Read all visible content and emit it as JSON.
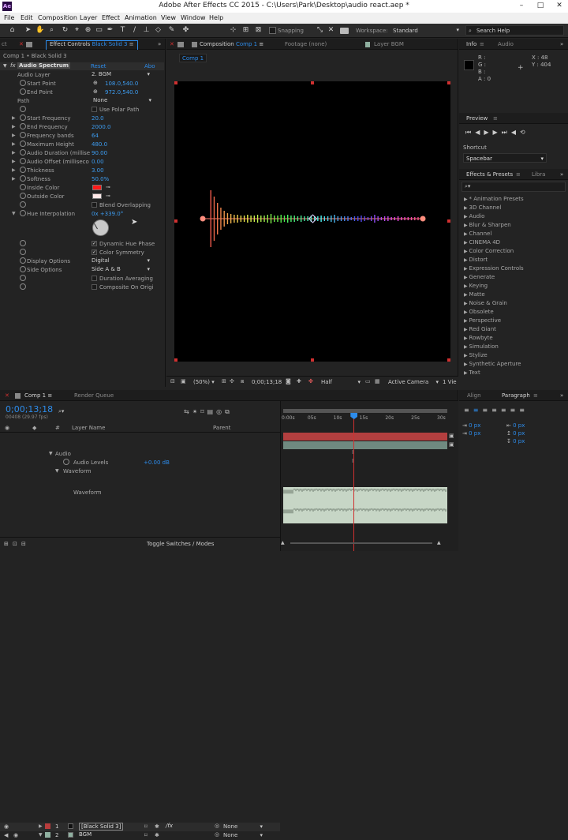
{
  "app": {
    "title": "Adobe After Effects CC 2015 - C:\\Users\\Park\\Desktop\\audio react.aep *",
    "logo": "Ae"
  },
  "menu": [
    "File",
    "Edit",
    "Composition",
    "Layer",
    "Effect",
    "Animation",
    "View",
    "Window",
    "Help"
  ],
  "toolbar": {
    "snapping": "Snapping",
    "workspace_label": "Workspace:",
    "workspace_value": "Standard",
    "search_placeholder": "Search Help"
  },
  "effect_controls": {
    "tab_prev": "ct",
    "tab_label": "Effect Controls",
    "tab_layer": "Black Solid 3",
    "breadcrumb": "Comp 1 • Black Solid 3",
    "effect_name": "Audio Spectrum",
    "reset": "Reset",
    "about": "Abo",
    "props": {
      "audio_layer": {
        "label": "Audio Layer",
        "value": "2. BGM"
      },
      "start_point": {
        "label": "Start Point",
        "value": "108.0,540.0"
      },
      "end_point": {
        "label": "End Point",
        "value": "972.0,540.0"
      },
      "path": {
        "label": "Path",
        "value": "None"
      },
      "use_polar": {
        "label": "Use Polar Path"
      },
      "start_freq": {
        "label": "Start Frequency",
        "value": "20.0"
      },
      "end_freq": {
        "label": "End Frequency",
        "value": "2000.0"
      },
      "freq_bands": {
        "label": "Frequency bands",
        "value": "64"
      },
      "max_height": {
        "label": "Maximum Height",
        "value": "480.0"
      },
      "audio_duration": {
        "label": "Audio Duration (millise",
        "value": "90.00"
      },
      "audio_offset": {
        "label": "Audio Offset (milliseco",
        "value": "0.00"
      },
      "thickness": {
        "label": "Thickness",
        "value": "3.00"
      },
      "softness": {
        "label": "Softness",
        "value": "50.0%"
      },
      "inside_color": {
        "label": "Inside Color",
        "color": "#ff1a1a"
      },
      "outside_color": {
        "label": "Outside Color",
        "color": "#ffe8e8"
      },
      "blend_overlapping": {
        "label": "Blend Overlapping"
      },
      "hue_interp": {
        "label": "Hue Interpolation",
        "value": "0x +339.0°"
      },
      "dynamic_hue": {
        "label": "Dynamic Hue Phase"
      },
      "color_symmetry": {
        "label": "Color Symmetry"
      },
      "display_options": {
        "label": "Display Options",
        "value": "Digital"
      },
      "side_options": {
        "label": "Side Options",
        "value": "Side A & B"
      },
      "duration_avg": {
        "label": "Duration Averaging"
      },
      "composite": {
        "label": "Composite On Origi"
      }
    }
  },
  "composition": {
    "tab_label": "Composition",
    "tab_name": "Comp 1",
    "footage_tab": "Footage (none)",
    "layer_tab": "Layer BGM",
    "comp_chip": "Comp 1",
    "zoom": "(50%)",
    "timecode": "0;00;13;18",
    "resolution": "Half",
    "camera": "Active Camera",
    "views": "1 Vie"
  },
  "info": {
    "tab_info": "Info",
    "tab_audio": "Audio",
    "r": "R :",
    "g": "G :",
    "b": "B :",
    "a": "A : 0",
    "x": "X : 48",
    "y": "Y : 404"
  },
  "preview": {
    "title": "Preview",
    "shortcut_label": "Shortcut",
    "shortcut_value": "Spacebar"
  },
  "effects_presets": {
    "title": "Effects & Presets",
    "tab_lib": "Libra",
    "items": [
      "* Animation Presets",
      "3D Channel",
      "Audio",
      "Blur & Sharpen",
      "Channel",
      "CINEMA 4D",
      "Color Correction",
      "Distort",
      "Expression Controls",
      "Generate",
      "Keying",
      "Matte",
      "Noise & Grain",
      "Obsolete",
      "Perspective",
      "Red Giant",
      "Rowbyte",
      "Simulation",
      "Stylize",
      "Synthetic Aperture",
      "Text"
    ]
  },
  "align": {
    "tab_align": "Align",
    "tab_paragraph": "Paragraph",
    "px_values": [
      "0 px",
      "0 px",
      "0 px",
      "0 px",
      "0 px"
    ]
  },
  "timeline": {
    "tab_comp": "Comp 1",
    "tab_render": "Render Queue",
    "timecode": "0;00;13;18",
    "fps": "00408 (29.97 fps)",
    "col_layer": "Layer Name",
    "col_parent": "Parent",
    "layers": [
      {
        "num": "1",
        "name": "[Black Solid 3]",
        "parent": "None",
        "color": "#b83c3c"
      },
      {
        "num": "2",
        "name": "BGM",
        "parent": "None",
        "color": "#8fb0a0"
      }
    ],
    "audio_group": "Audio",
    "audio_levels_label": "Audio Levels",
    "audio_levels_value": "+0.00 dB",
    "waveform_group": "Waveform",
    "waveform_label": "Waveform",
    "ruler": [
      "0:00s",
      "05s",
      "10s",
      "15s",
      "20s",
      "25s",
      "30s"
    ],
    "playhead_seconds": 13.6,
    "toggle": "Toggle Switches / Modes"
  },
  "colors": {
    "accent": "#2d8ceb",
    "playhead": "#d03030"
  }
}
